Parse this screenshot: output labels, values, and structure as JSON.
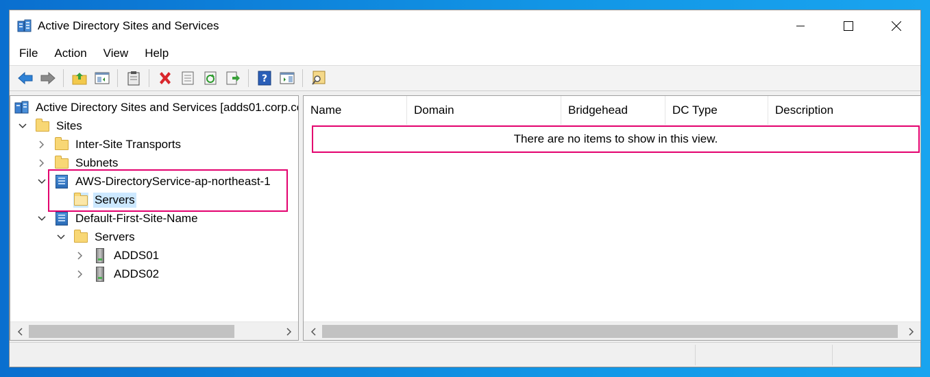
{
  "window": {
    "title": "Active Directory Sites and Services"
  },
  "menu": [
    "File",
    "Action",
    "View",
    "Help"
  ],
  "toolbar": {
    "buttons": [
      "back-icon",
      "forward-icon",
      "up-folder-icon",
      "show-hide-console-tree-icon",
      "clipboard-icon",
      "delete-icon",
      "properties-icon",
      "refresh-icon",
      "export-list-icon",
      "help-icon",
      "show-hide-action-pane-icon",
      "find-icon"
    ]
  },
  "tree": {
    "root": "Active Directory Sites and Services [adds01.corp.co",
    "sites": "Sites",
    "inter_site": "Inter-Site Transports",
    "subnets": "Subnets",
    "aws_site": "AWS-DirectoryService-ap-northeast-1",
    "aws_servers": "Servers",
    "default_site": "Default-First-Site-Name",
    "default_servers": "Servers",
    "adds01": "ADDS01",
    "adds02": "ADDS02"
  },
  "list": {
    "columns": [
      "Name",
      "Domain",
      "Bridgehead",
      "DC Type",
      "Description"
    ],
    "empty_message": "There are no items to show in this view."
  },
  "colors": {
    "highlight": "#e3006e",
    "selection": "#cce8ff",
    "desktop": "#1296e6"
  }
}
